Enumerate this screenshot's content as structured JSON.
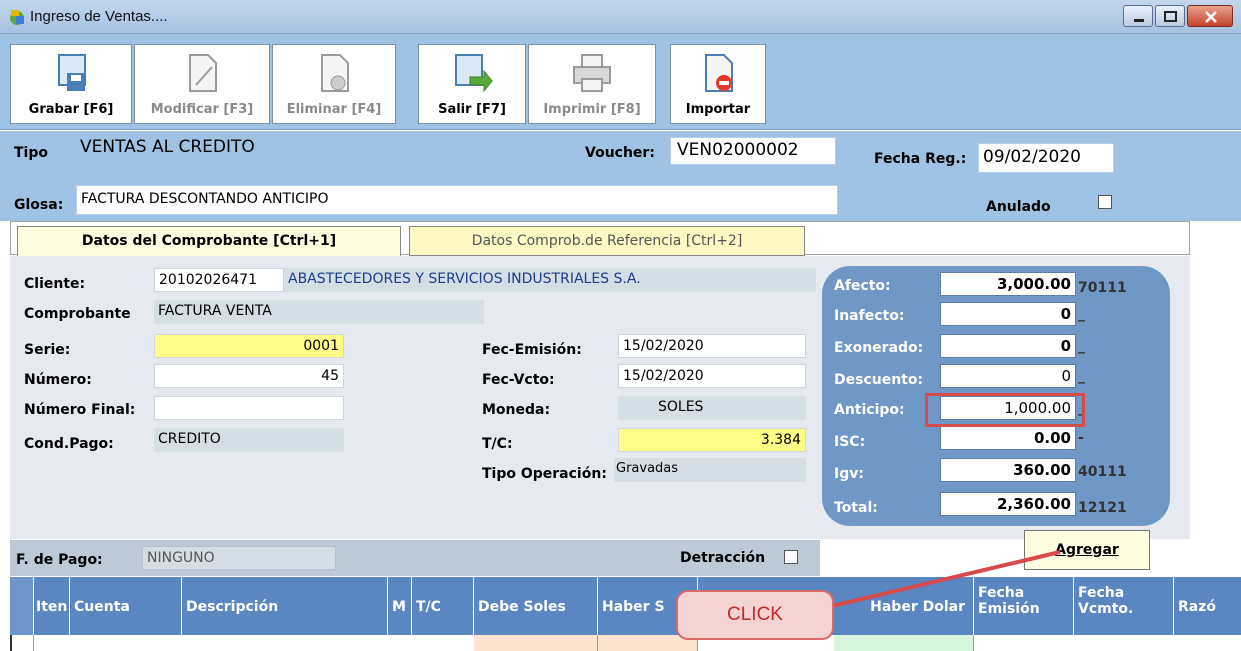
{
  "window": {
    "title": "Ingreso de Ventas...."
  },
  "toolbar": {
    "grabar": "Grabar [F6]",
    "modificar": "Modificar [F3]",
    "eliminar": "Eliminar [F4]",
    "salir": "Salir [F7]",
    "imprimir": "Imprimir [F8]",
    "importar": "Importar"
  },
  "header": {
    "tipo_label": "Tipo",
    "tipo_value": "VENTAS AL CREDITO",
    "voucher_label": "Voucher:",
    "voucher_value": "VEN02000002",
    "fecha_label": "Fecha Reg.:",
    "fecha_value": "09/02/2020",
    "glosa_label": "Glosa:",
    "glosa_value": "FACTURA DESCONTANDO ANTICIPO",
    "anulado_label": "Anulado"
  },
  "tabs": [
    {
      "label": "Datos del Comprobante [Ctrl+1]"
    },
    {
      "label": "Datos Comprob.de Referencia [Ctrl+2]"
    }
  ],
  "form": {
    "cliente_label": "Cliente:",
    "cliente_ruc": "20102026471",
    "cliente_nombre": "ABASTECEDORES Y SERVICIOS INDUSTRIALES S.A.",
    "comprobante_label": "Comprobante",
    "comprobante_value": "FACTURA VENTA",
    "serie_label": "Serie:",
    "serie_value": "0001",
    "numero_label": "Número:",
    "numero_value": "45",
    "numero_final_label": "Número Final:",
    "numero_final_value": "",
    "cond_pago_label": "Cond.Pago:",
    "cond_pago_value": "CREDITO",
    "fec_emision_label": "Fec-Emisión:",
    "fec_emision_value": "15/02/2020",
    "fec_vcto_label": "Fec-Vcto:",
    "fec_vcto_value": "15/02/2020",
    "moneda_label": "Moneda:",
    "moneda_value": "SOLES",
    "tc_label": "T/C:",
    "tc_value": "3.384",
    "tipo_operacion_label": "Tipo Operación:",
    "tipo_operacion_value": "Gravadas",
    "fpago_label": "F. de Pago:",
    "fpago_value": "NINGUNO",
    "detraccion_label": "Detracción"
  },
  "totals": [
    {
      "label": "Afecto:",
      "value": "3,000.00",
      "code": "70111",
      "bold": true
    },
    {
      "label": "Inafecto:",
      "value": "0",
      "code": "_",
      "bold": true
    },
    {
      "label": "Exonerado:",
      "value": "0",
      "code": "_",
      "bold": true
    },
    {
      "label": "Descuento:",
      "value": "0",
      "code": "_",
      "bold": false
    },
    {
      "label": "Anticipo:",
      "value": "1,000.00",
      "code": "_",
      "bold": false
    },
    {
      "label": "ISC:",
      "value": "0.00",
      "code": "-",
      "bold": true
    },
    {
      "label": "Igv:",
      "value": "360.00",
      "code": "40111",
      "bold": true
    },
    {
      "label": "Total:",
      "value": "2,360.00",
      "code": "12121",
      "bold": true
    }
  ],
  "agregar_label": "Agregar",
  "grid_headers": [
    "Iten",
    "Cuenta",
    "Descripción",
    "M",
    "T/C",
    "Debe Soles",
    "Haber S",
    "Haber Dolar",
    "Fecha Emisión",
    "Fecha Vcmto.",
    "Razó"
  ],
  "callout": "CLICK",
  "colors": {
    "toolbar": "#9ec3e4",
    "grid_header": "#5a87c2",
    "totals_panel": "#6f98c6",
    "highlight": "#d94a4a"
  }
}
